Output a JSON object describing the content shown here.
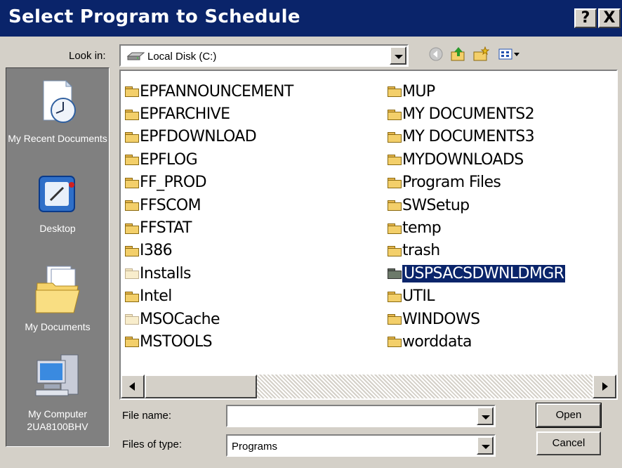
{
  "window": {
    "title": "Select Program to Schedule",
    "help_label": "?",
    "close_label": "X"
  },
  "toolbar": {
    "look_in_label": "Look in:",
    "look_in_value": "Local Disk (C:)",
    "back_icon": "back-arrow-icon",
    "up_icon": "up-folder-icon",
    "new_folder_icon": "new-folder-icon",
    "views_icon": "views-menu-icon"
  },
  "places": [
    {
      "label": "My Recent Documents",
      "icon": "recent-documents-icon"
    },
    {
      "label": "Desktop",
      "icon": "desktop-icon"
    },
    {
      "label": "My Documents",
      "icon": "my-documents-icon"
    },
    {
      "label": "My Computer 2UA8100BHV",
      "icon": "my-computer-icon"
    }
  ],
  "files": {
    "left_column": [
      {
        "name": "EPFANNOUNCEMENT",
        "style": "normal"
      },
      {
        "name": "EPFARCHIVE",
        "style": "normal"
      },
      {
        "name": "EPFDOWNLOAD",
        "style": "normal"
      },
      {
        "name": "EPFLOG",
        "style": "normal"
      },
      {
        "name": "FF_PROD",
        "style": "normal"
      },
      {
        "name": "FFSCOM",
        "style": "normal"
      },
      {
        "name": "FFSTAT",
        "style": "normal"
      },
      {
        "name": "I386",
        "style": "normal"
      },
      {
        "name": "Installs",
        "style": "pale"
      },
      {
        "name": "Intel",
        "style": "normal"
      },
      {
        "name": "MSOCache",
        "style": "pale"
      },
      {
        "name": "MSTOOLS",
        "style": "normal"
      }
    ],
    "right_column": [
      {
        "name": "MUP",
        "style": "normal"
      },
      {
        "name": "MY DOCUMENTS2",
        "style": "normal"
      },
      {
        "name": "MY DOCUMENTS3",
        "style": "normal"
      },
      {
        "name": "MYDOWNLOADS",
        "style": "normal"
      },
      {
        "name": "Program Files",
        "style": "normal"
      },
      {
        "name": "SWSetup",
        "style": "normal"
      },
      {
        "name": "temp",
        "style": "normal"
      },
      {
        "name": "trash",
        "style": "normal"
      },
      {
        "name": "USPSACSDWNLDMGR",
        "style": "dark",
        "selected": true
      },
      {
        "name": "UTIL",
        "style": "normal"
      },
      {
        "name": "WINDOWS",
        "style": "normal"
      },
      {
        "name": "worddata",
        "style": "normal"
      }
    ]
  },
  "form": {
    "file_name_label": "File name:",
    "file_name_value": "",
    "file_type_label": "Files of type:",
    "file_type_value": "Programs",
    "open_label": "Open",
    "cancel_label": "Cancel"
  }
}
